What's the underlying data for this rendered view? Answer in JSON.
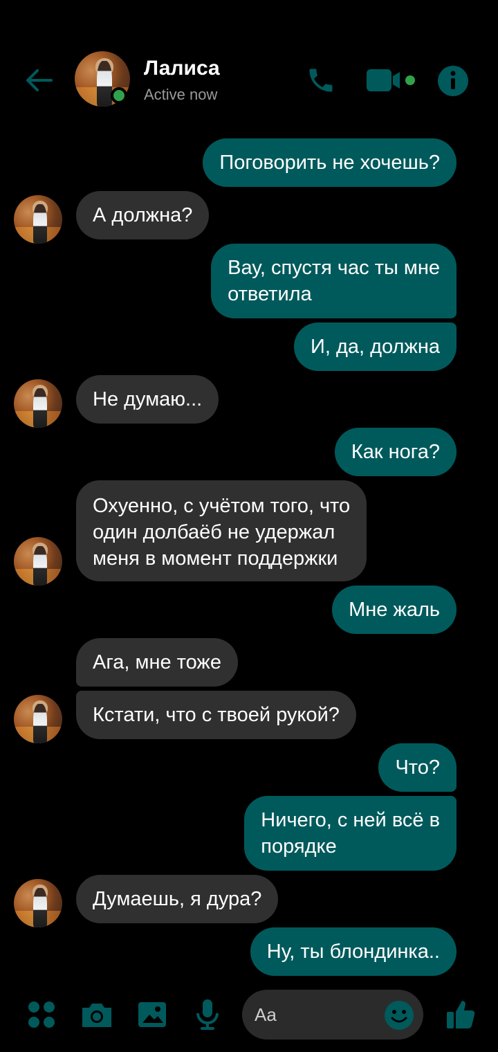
{
  "header": {
    "contact_name": "Лалиса",
    "status": "Active now"
  },
  "messages": [
    {
      "side": "out",
      "text": "Поговорить не хочешь?"
    },
    {
      "side": "in",
      "text": "А должна?"
    },
    {
      "side": "out",
      "text": "Вау, спустя час ты мне\nответила"
    },
    {
      "side": "out",
      "text": "И, да, должна"
    },
    {
      "side": "in",
      "text": "Не думаю..."
    },
    {
      "side": "out",
      "text": "Как нога?"
    },
    {
      "side": "in",
      "text": "Охуенно, с учётом того, что\nодин долбаёб не удержал\nменя в момент поддержки"
    },
    {
      "side": "out",
      "text": "Мне жаль"
    },
    {
      "side": "in",
      "text": "Ага, мне тоже"
    },
    {
      "side": "in",
      "text": "Кстати, что с твоей рукой?"
    },
    {
      "side": "out",
      "text": "Что?"
    },
    {
      "side": "out",
      "text": "Ничего, с ней всё в\nпорядке"
    },
    {
      "side": "in",
      "text": "Думаешь, я дура?"
    },
    {
      "side": "out",
      "text": "Ну, ты блондинка.."
    }
  ],
  "composer": {
    "placeholder": "Aa"
  },
  "icons": {
    "back": "arrow-left-icon",
    "call": "phone-icon",
    "video": "video-camera-icon",
    "info": "info-icon",
    "menu": "four-dots-icon",
    "camera": "camera-icon",
    "gallery": "image-icon",
    "mic": "microphone-icon",
    "emoji": "smiley-icon",
    "like": "thumbs-up-icon"
  },
  "colors": {
    "accent": "#005a5c",
    "incoming_bubble": "#303030",
    "background": "#000000",
    "online": "#31a24c"
  }
}
